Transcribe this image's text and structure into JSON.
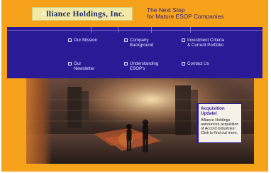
{
  "header": {
    "logo_first_letter": "A",
    "logo_rest": "lliance Holdings, Inc.",
    "tagline_line1": "The Next Step",
    "tagline_line2": "for Mature ESOP Companies"
  },
  "nav": {
    "items": [
      {
        "label": "Our Mission",
        "icon": "page-icon"
      },
      {
        "label": "Company\nBackground",
        "icon": "page-icon"
      },
      {
        "label": "Investment Criteria\n& Current Portfolio",
        "icon": "page-icon"
      },
      {
        "label": "Our\nNewsletter",
        "icon": "page-icon"
      },
      {
        "label": "Understanding\nESOP's",
        "icon": "page-icon"
      },
      {
        "label": "Contact Us",
        "icon": "page-icon"
      }
    ]
  },
  "news": {
    "title": "Acquisition Update!",
    "body": "Alliance Holdings\nannounces acquisition\nof Accord Industries!\nClick to find out more."
  },
  "colors": {
    "background": "#f7a21b",
    "nav": "#2b1a96",
    "logo_bg": "#f2e9a6",
    "tagline": "#2a1f8a"
  }
}
